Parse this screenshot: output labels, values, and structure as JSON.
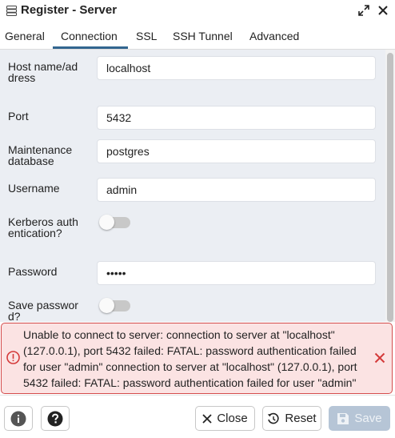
{
  "window": {
    "title": "Register - Server"
  },
  "tabs": [
    {
      "label": "General"
    },
    {
      "label": "Connection",
      "active": true
    },
    {
      "label": "SSL"
    },
    {
      "label": "SSH Tunnel"
    },
    {
      "label": "Advanced"
    }
  ],
  "form": {
    "host_label": "Host name/address",
    "host_value": "localhost",
    "port_label": "Port",
    "port_value": "5432",
    "maintenance_label": "Maintenance database",
    "maintenance_value": "postgres",
    "username_label": "Username",
    "username_value": "admin",
    "kerberos_label": "Kerberos authentication?",
    "kerberos_enabled": false,
    "password_label": "Password",
    "password_value": "•••••",
    "save_password_label": "Save password?",
    "save_password_enabled": false
  },
  "error": {
    "message": "Unable to connect to server: connection to server at \"localhost\" (127.0.0.1), port 5432 failed: FATAL: password authentication failed for user \"admin\" connection to server at \"localhost\" (127.0.0.1), port 5432 failed: FATAL: password authentication failed for user \"admin\""
  },
  "buttons": {
    "close_label": "Close",
    "reset_label": "Reset",
    "save_label": "Save"
  },
  "colors": {
    "accent": "#326690",
    "error_border": "#d44d4d",
    "error_bg": "#fbe3e3",
    "form_bg": "#ebeef3",
    "save_disabled": "#b6c5d6"
  }
}
